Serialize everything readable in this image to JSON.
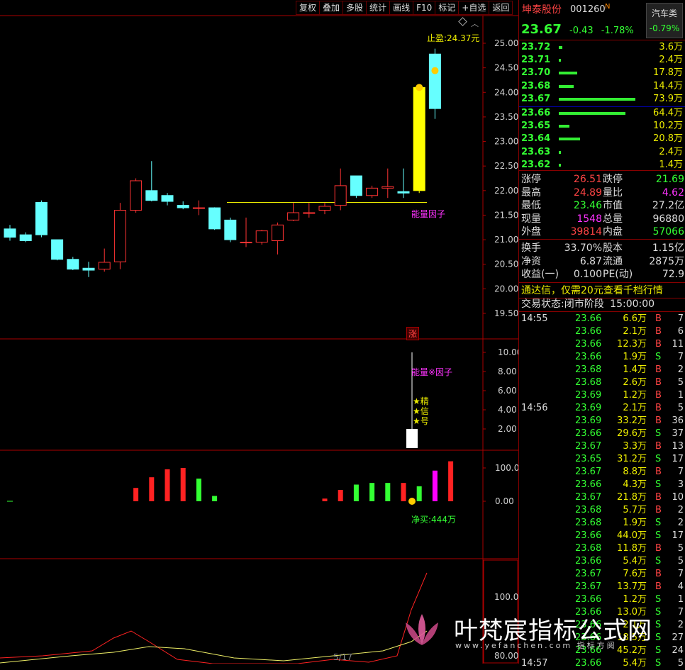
{
  "toolbar": {
    "buttons": [
      "复权",
      "叠加",
      "多股",
      "统计",
      "画线",
      "F10",
      "标记",
      "+自选",
      "返回"
    ]
  },
  "stock": {
    "name": "坤泰股份",
    "code": "001260",
    "flag": "N",
    "sector": "汽车类",
    "sector_change": "-0.79%",
    "price": "23.67",
    "change": "-0.43",
    "pct": "-1.78%"
  },
  "asks": [
    {
      "label": "23.72",
      "vol": "3.6万",
      "bar": 0.05
    },
    {
      "label": "23.71",
      "vol": "2.4万",
      "bar": 0.03
    },
    {
      "label": "23.70",
      "vol": "17.8万",
      "bar": 0.24
    },
    {
      "label": "23.68",
      "vol": "14.4万",
      "bar": 0.19
    },
    {
      "label": "23.67",
      "vol": "73.9万",
      "bar": 1.0
    }
  ],
  "bids": [
    {
      "label": "23.66",
      "vol": "64.4万",
      "bar": 0.87
    },
    {
      "label": "23.65",
      "vol": "10.2万",
      "bar": 0.14
    },
    {
      "label": "23.64",
      "vol": "20.8万",
      "bar": 0.28
    },
    {
      "label": "23.63",
      "vol": "2.4万",
      "bar": 0.03
    },
    {
      "label": "23.62",
      "vol": "1.4万",
      "bar": 0.02
    }
  ],
  "stats": [
    {
      "k1": "涨停",
      "v1": "26.51",
      "c1": "r",
      "k2": "跌停",
      "v2": "21.69",
      "c2": "g"
    },
    {
      "k1": "最高",
      "v1": "24.89",
      "c1": "r",
      "k2": "量比",
      "v2": "4.62",
      "c2": "m"
    },
    {
      "k1": "最低",
      "v1": "23.46",
      "c1": "g",
      "k2": "市值",
      "v2": "27.2亿",
      "c2": "w"
    },
    {
      "k1": "现量",
      "v1": "1548",
      "c1": "m",
      "k2": "总量",
      "v2": "96880",
      "c2": "w"
    },
    {
      "k1": "外盘",
      "v1": "39814",
      "c1": "r",
      "k2": "内盘",
      "v2": "57066",
      "c2": "g"
    }
  ],
  "stats2": [
    {
      "k1": "换手",
      "v1": "33.70%",
      "k2": "股本",
      "v2": "1.15亿"
    },
    {
      "k1": "净资",
      "v1": "6.87",
      "k2": "流通",
      "v2": "2875万"
    },
    {
      "k1": "收益(一)",
      "v1": "0.100",
      "k2": "PE(动)",
      "v2": "72.9"
    }
  ],
  "notice": "通达信，仅需20元查看千档行情",
  "trade_state": "交易状态:闭市阶段",
  "trade_time": "15:00:00",
  "ticks": [
    {
      "t": "14:55",
      "p": "23.66",
      "v": "6.6万",
      "d": "B",
      "n": "7"
    },
    {
      "t": "",
      "p": "23.66",
      "v": "2.1万",
      "d": "B",
      "n": "6"
    },
    {
      "t": "",
      "p": "23.66",
      "v": "12.3万",
      "d": "B",
      "n": "11"
    },
    {
      "t": "",
      "p": "23.66",
      "v": "1.9万",
      "d": "S",
      "n": "7"
    },
    {
      "t": "",
      "p": "23.68",
      "v": "1.4万",
      "d": "B",
      "n": "2"
    },
    {
      "t": "",
      "p": "23.68",
      "v": "2.6万",
      "d": "B",
      "n": "5"
    },
    {
      "t": "",
      "p": "23.69",
      "v": "1.2万",
      "d": "B",
      "n": "1"
    },
    {
      "t": "14:56",
      "p": "23.69",
      "v": "2.1万",
      "d": "B",
      "n": "5"
    },
    {
      "t": "",
      "p": "23.69",
      "v": "33.2万",
      "d": "B",
      "n": "36"
    },
    {
      "t": "",
      "p": "23.66",
      "v": "29.6万",
      "d": "S",
      "n": "37"
    },
    {
      "t": "",
      "p": "23.67",
      "v": "3.3万",
      "d": "B",
      "n": "13"
    },
    {
      "t": "",
      "p": "23.65",
      "v": "31.2万",
      "d": "S",
      "n": "17"
    },
    {
      "t": "",
      "p": "23.67",
      "v": "8.8万",
      "d": "B",
      "n": "7"
    },
    {
      "t": "",
      "p": "23.66",
      "v": "4.3万",
      "d": "S",
      "n": "3"
    },
    {
      "t": "",
      "p": "23.67",
      "v": "21.8万",
      "d": "B",
      "n": "10"
    },
    {
      "t": "",
      "p": "23.68",
      "v": "5.7万",
      "d": "B",
      "n": "2"
    },
    {
      "t": "",
      "p": "23.68",
      "v": "1.9万",
      "d": "S",
      "n": "2"
    },
    {
      "t": "",
      "p": "23.66",
      "v": "44.0万",
      "d": "S",
      "n": "17"
    },
    {
      "t": "",
      "p": "23.68",
      "v": "11.8万",
      "d": "B",
      "n": "5"
    },
    {
      "t": "",
      "p": "23.66",
      "v": "5.4万",
      "d": "S",
      "n": "5"
    },
    {
      "t": "",
      "p": "23.67",
      "v": "7.6万",
      "d": "B",
      "n": "7"
    },
    {
      "t": "",
      "p": "23.67",
      "v": "13.7万",
      "d": "B",
      "n": "4"
    },
    {
      "t": "",
      "p": "23.66",
      "v": "1.2万",
      "d": "S",
      "n": "1"
    },
    {
      "t": "",
      "p": "23.66",
      "v": "13.0万",
      "d": "S",
      "n": "7"
    },
    {
      "t": "",
      "p": "23.66",
      "v": "2.1万",
      "d": "S",
      "n": "2"
    },
    {
      "t": "",
      "p": "23.66",
      "v": "18.5万",
      "d": "S",
      "n": "27"
    },
    {
      "t": "",
      "p": "23.66",
      "v": "45.2万",
      "d": "S",
      "n": "24"
    },
    {
      "t": "14:57",
      "p": "23.66",
      "v": "5.4万",
      "d": "S",
      "n": "5"
    }
  ],
  "chart_labels": {
    "take_profit": "止盈:24.37元",
    "energy": "能量因子",
    "energy2": "能量※因子",
    "star1": "★精",
    "star2": "★信",
    "star3": "★号",
    "zhang": "涨",
    "net_buy": "净买:444万",
    "page": "5/17"
  },
  "watermark": {
    "name": "叶梵宸指标公式网",
    "url": "www.yefanchen.com 指标方阅"
  },
  "chart_data": [
    {
      "type": "candlestick",
      "ylim": [
        19.5,
        25.0
      ],
      "yticks": [
        "25.00",
        "24.50",
        "24.00",
        "23.50",
        "23.00",
        "22.50",
        "22.00",
        "21.50",
        "21.00",
        "20.50",
        "20.00",
        "19.50"
      ],
      "candles": [
        {
          "o": 21.22,
          "c": 21.05,
          "h": 21.3,
          "l": 20.98
        },
        {
          "o": 21.1,
          "c": 20.98,
          "h": 21.15,
          "l": 20.95
        },
        {
          "o": 21.76,
          "c": 21.1,
          "h": 21.8,
          "l": 21.05
        },
        {
          "o": 21.0,
          "c": 20.6,
          "h": 21.0,
          "l": 20.58
        },
        {
          "o": 20.6,
          "c": 20.4,
          "h": 20.65,
          "l": 20.38
        },
        {
          "o": 20.42,
          "c": 20.38,
          "h": 20.55,
          "l": 20.24
        },
        {
          "o": 20.4,
          "c": 20.54,
          "h": 20.82,
          "l": 20.35
        },
        {
          "o": 20.55,
          "c": 21.6,
          "h": 21.75,
          "l": 20.4
        },
        {
          "o": 21.6,
          "c": 22.2,
          "h": 22.25,
          "l": 21.55
        },
        {
          "o": 22.0,
          "c": 21.8,
          "h": 22.6,
          "l": 21.78
        },
        {
          "o": 21.9,
          "c": 21.78,
          "h": 21.95,
          "l": 21.7
        },
        {
          "o": 21.7,
          "c": 21.65,
          "h": 21.78,
          "l": 21.62
        },
        {
          "o": 21.65,
          "c": 21.65,
          "h": 21.8,
          "l": 21.5
        },
        {
          "o": 21.65,
          "c": 21.22,
          "h": 21.66,
          "l": 21.2
        },
        {
          "o": 21.4,
          "c": 21.0,
          "h": 21.45,
          "l": 20.95
        },
        {
          "o": 20.95,
          "c": 20.95,
          "h": 21.45,
          "l": 20.85
        },
        {
          "o": 20.95,
          "c": 21.18,
          "h": 21.2,
          "l": 20.9
        },
        {
          "o": 20.98,
          "c": 21.3,
          "h": 21.35,
          "l": 20.7
        },
        {
          "o": 21.4,
          "c": 21.55,
          "h": 21.75,
          "l": 21.38
        },
        {
          "o": 21.55,
          "c": 21.55,
          "h": 21.75,
          "l": 21.45
        },
        {
          "o": 21.6,
          "c": 21.68,
          "h": 21.75,
          "l": 21.52
        },
        {
          "o": 21.7,
          "c": 22.1,
          "h": 22.45,
          "l": 21.6
        },
        {
          "o": 22.3,
          "c": 21.9,
          "h": 22.3,
          "l": 21.85
        },
        {
          "o": 21.9,
          "c": 22.05,
          "h": 22.1,
          "l": 21.85
        },
        {
          "o": 22.05,
          "c": 22.08,
          "h": 22.45,
          "l": 21.85
        },
        {
          "o": 21.98,
          "c": 21.95,
          "h": 22.45,
          "l": 21.85
        },
        {
          "o": 22.0,
          "c": 24.1,
          "h": 24.15,
          "l": 21.95
        },
        {
          "o": 24.78,
          "c": 23.67,
          "h": 24.89,
          "l": 23.46
        }
      ],
      "marker_line": 21.76,
      "take_profit": 24.37
    },
    {
      "type": "bar",
      "ylim": [
        0,
        10
      ],
      "yticks": [
        "10.00",
        "8.00",
        "6.00",
        "4.00",
        "2.00"
      ],
      "values": [
        2
      ]
    },
    {
      "type": "bar",
      "ylim": [
        -10,
        110
      ],
      "yticks": [
        "100.0",
        "0.00"
      ],
      "values": [
        0,
        0,
        0,
        0,
        0,
        0,
        0,
        0,
        40,
        72,
        96,
        100,
        68,
        16,
        0,
        0,
        0,
        0,
        0,
        0,
        8,
        34,
        50,
        55,
        55,
        55,
        45,
        92,
        120
      ]
    },
    {
      "type": "line",
      "ylim": [
        78,
        115
      ],
      "yticks": [
        "100.0",
        "80.00"
      ]
    }
  ]
}
